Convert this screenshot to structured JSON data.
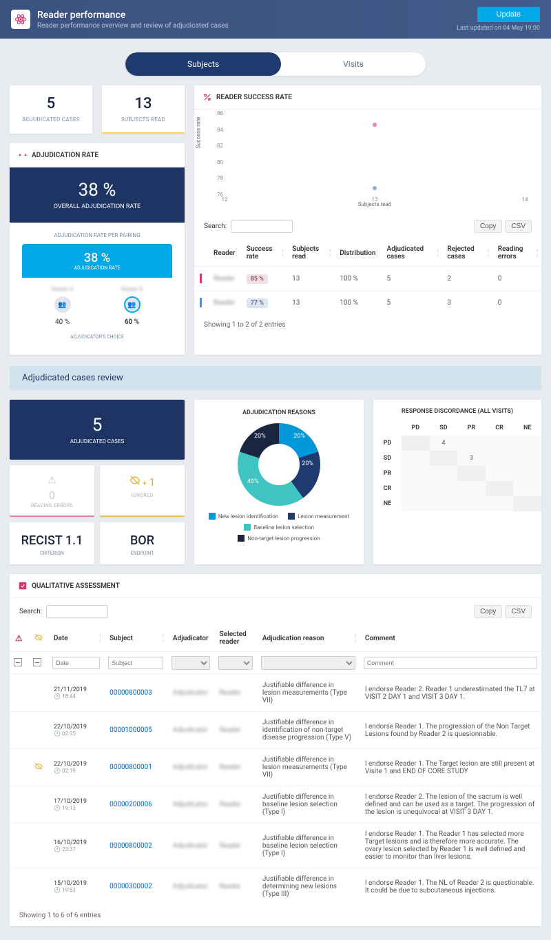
{
  "header": {
    "title": "Reader performance",
    "subtitle": "Reader performance overview and review of adjudicated cases",
    "update_btn": "Update",
    "last_updated": "Last updated on 04 May 19:00"
  },
  "tabs": {
    "subjects": "Subjects",
    "visits": "Visits"
  },
  "stats": {
    "adjudicated_cases": {
      "value": "5",
      "label": "ADJUDICATED CASES"
    },
    "subjects_read": {
      "value": "13",
      "label": "SUBJECTS READ"
    }
  },
  "adj_rate": {
    "title": "ADJUDICATION RATE",
    "overall_val": "38 %",
    "overall_label": "OVERALL ADJUDICATION RATE",
    "per_pairing_label": "ADJUDICATION RATE PER PAIRING",
    "pairing_val": "38 %",
    "pairing_lbl": "ADJUDICATION RATE",
    "reader_a": {
      "pct": "40 %"
    },
    "reader_b": {
      "pct": "60 %"
    },
    "choice_label": "ADJUDICATOR'S CHOICE"
  },
  "success": {
    "title": "READER SUCCESS RATE",
    "search_label": "Search:",
    "copy_btn": "Copy",
    "csv_btn": "CSV",
    "columns": [
      "Reader",
      "Success rate",
      "Subjects read",
      "Distribution",
      "Adjudicated cases",
      "Rejected cases",
      "Reading errors"
    ],
    "rows": [
      {
        "rate": "85 %",
        "subjects": "13",
        "dist": "100 %",
        "adj": "5",
        "rej": "2",
        "err": "0",
        "bar": "pink"
      },
      {
        "rate": "77 %",
        "subjects": "13",
        "dist": "100 %",
        "adj": "5",
        "rej": "3",
        "err": "0",
        "bar": "blue"
      }
    ],
    "info": "Showing 1 to 2 of 2 entries"
  },
  "chart_data": {
    "type": "scatter",
    "title": "",
    "xlabel": "Subjects read",
    "ylabel": "Success rate",
    "x_ticks": [
      12,
      13,
      14
    ],
    "y_ticks": [
      76,
      78,
      80,
      82,
      84,
      86
    ],
    "xlim": [
      12,
      14
    ],
    "ylim": [
      76,
      86
    ],
    "series": [
      {
        "name": "Reader A",
        "color": "#e08aa8",
        "x": [
          13
        ],
        "y": [
          85
        ]
      },
      {
        "name": "Reader B",
        "color": "#8cb0d6",
        "x": [
          13
        ],
        "y": [
          77
        ]
      }
    ]
  },
  "review_banner": "Adjudicated cases review",
  "review_left": {
    "cases_val": "5",
    "cases_lbl": "ADJUDICATED CASES",
    "errors_val": "0",
    "errors_lbl": "READING ERRORS",
    "ignored_plus": "+",
    "ignored_val": "1",
    "ignored_lbl": "IGNORED",
    "criterion_val": "RECIST 1.1",
    "criterion_lbl": "CRITERION",
    "endpoint_val": "BOR",
    "endpoint_lbl": "ENDPOINT"
  },
  "reasons": {
    "title": "ADJUDICATION REASONS",
    "slices": [
      {
        "label": "New lesion identification",
        "pct": "20%",
        "color": "#0098d8"
      },
      {
        "label": "Lesion measurement",
        "pct": "20%",
        "color": "#1e3a6e"
      },
      {
        "label": "Baseline lesion selection",
        "pct": "40%",
        "color": "#3fc4c1"
      },
      {
        "label": "Non-target lesion progression",
        "pct": "20%",
        "color": "#1a2540"
      }
    ]
  },
  "discordance": {
    "title": "RESPONSE DISCORDANCE (ALL VISITS)",
    "labels": [
      "PD",
      "SD",
      "PR",
      "CR",
      "NE"
    ],
    "cells": {
      "PD_SD": "4",
      "SD_PR": "3"
    }
  },
  "qual": {
    "title": "QUALITATIVE ASSESSMENT",
    "search_label": "Search:",
    "copy_btn": "Copy",
    "csv_btn": "CSV",
    "columns": [
      "Date",
      "Subject",
      "Adjudicator",
      "Selected reader",
      "Adjudication reason",
      "Comment"
    ],
    "filter_placeholders": {
      "date": "Date",
      "subject": "Subject",
      "comment": "Comment"
    },
    "rows": [
      {
        "date": "21/11/2019",
        "time": "18:44",
        "subject": "00000800003",
        "reason": "Justifiable difference in lesion measurements (Type VII)",
        "comment": "I endorse Reader 2. Reader 1 underestimated the TL7 at VISIT 2 DAY 1 and VISIT 3 DAY 1.",
        "ignored": false
      },
      {
        "date": "22/10/2019",
        "time": "02:25",
        "subject": "00001000005",
        "reason": "Justifiable difference in identification of non-target disease progression (Type V)",
        "comment": "I endorse Reader 1. The progression of the Non Target Lesions found by Reader 2 is quesionnable.",
        "ignored": false
      },
      {
        "date": "22/10/2019",
        "time": "02:19",
        "subject": "00000800001",
        "reason": "Justifiable difference in lesion measurements (Type VII)",
        "comment": "I endorse Reader 1. The Target lesion are still present at Visite 1 and END OF CORE STUDY",
        "ignored": true
      },
      {
        "date": "17/10/2019",
        "time": "19:13",
        "subject": "00000200006",
        "reason": "Justifiable difference in baseline lesion selection (Type I)",
        "comment": "I endorse Reader 2. The lesion of the sacrum is well defined and can be used as a target. The progression of the lesion is unequivocal at VISIT 3 DAY 1.",
        "ignored": false
      },
      {
        "date": "16/10/2019",
        "time": "23:37",
        "subject": "00000800002",
        "reason": "Justifiable difference in baseline lesion selection (Type I)",
        "comment": "I endorse Reader 1. The Reader 1 has selected more Target lesions and is therefore more accurate. The ovary lesion selected by Reader 1 is well defined and easier to monitor than liver lesions.",
        "ignored": false
      },
      {
        "date": "15/10/2019",
        "time": "19:53",
        "subject": "00000300002",
        "reason": "Justifiable difference in determining new lesions (Type III)",
        "comment": "I endorse Reader 1. The NL of Reader 2 is questionable. It could be due to subcutaneous injections.",
        "ignored": false
      }
    ],
    "info": "Showing 1 to 6 of 6 entries"
  }
}
